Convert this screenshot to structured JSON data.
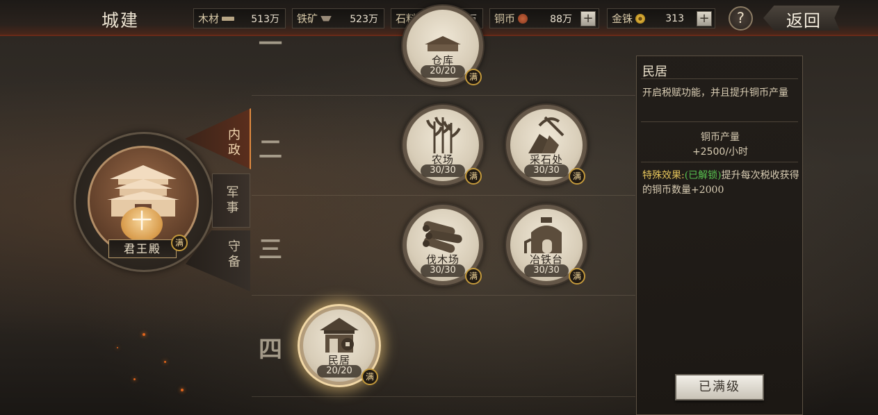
{
  "header": {
    "title": "城建",
    "resources": [
      {
        "name": "木材",
        "value": "513万",
        "icon": "wood-icon"
      },
      {
        "name": "铁矿",
        "value": "523万",
        "icon": "iron-icon"
      },
      {
        "name": "石料",
        "value": "495万",
        "icon": "stone-icon"
      },
      {
        "name": "铜币",
        "value": "88万",
        "icon": "copper-coin-icon"
      },
      {
        "name": "金铢",
        "value": "313",
        "icon": "gold-coin-icon"
      }
    ],
    "plus_label": "+",
    "help_label": "?",
    "back_label": "返回"
  },
  "palace": {
    "level_glyph": "十",
    "name": "君王殿",
    "max_label": "满"
  },
  "tabs": [
    {
      "label": "内政",
      "active": true
    },
    {
      "label": "军事",
      "active": false
    },
    {
      "label": "守备",
      "active": false
    }
  ],
  "tiers": {
    "labels": [
      "一",
      "二",
      "三",
      "四"
    ]
  },
  "buildings": [
    {
      "name": "仓库",
      "level": "20/20",
      "max": "满",
      "tier": 1,
      "icon": "warehouse-icon"
    },
    {
      "name": "农场",
      "level": "30/30",
      "max": "满",
      "tier": 2,
      "icon": "farm-icon"
    },
    {
      "name": "采石处",
      "level": "30/30",
      "max": "满",
      "tier": 2,
      "icon": "quarry-icon"
    },
    {
      "name": "伐木场",
      "level": "30/30",
      "max": "满",
      "tier": 3,
      "icon": "lumber-icon"
    },
    {
      "name": "冶铁台",
      "level": "30/30",
      "max": "满",
      "tier": 3,
      "icon": "smelter-icon"
    },
    {
      "name": "民居",
      "level": "20/20",
      "max": "满",
      "tier": 4,
      "icon": "residence-icon",
      "selected": true
    }
  ],
  "info": {
    "title": "民居",
    "description": "开启税赋功能，并且提升铜币产量",
    "production_label": "铜币产量",
    "production_value": "+2500/小时",
    "special_label": "特殊效果:",
    "special_status": "(已解锁)",
    "special_text": "提升每次税收获得的铜币数量+2000",
    "button_label": "已满级"
  },
  "colors": {
    "accent_gold": "#e3c35a",
    "unlocked_green": "#58c24f",
    "active_tab": "#e08a40"
  }
}
